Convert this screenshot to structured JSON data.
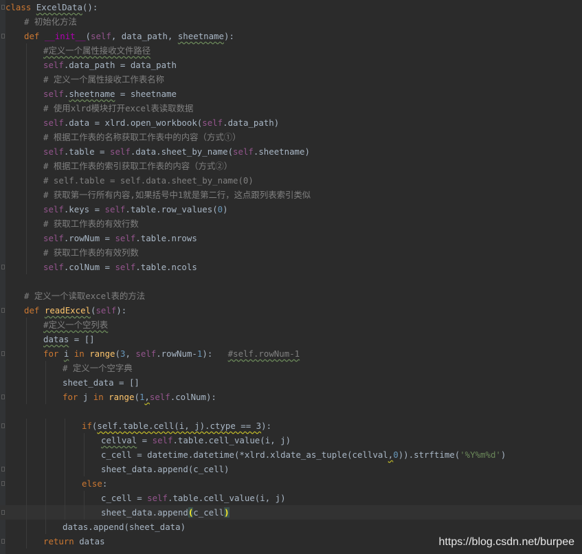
{
  "editor": {
    "lines": [
      [
        {
          "t": "class",
          "c": "kw"
        },
        {
          "t": " "
        },
        {
          "t": "ExcelData",
          "c": "squig"
        },
        {
          "t": "():"
        }
      ],
      [
        {
          "t": "# 初始化方法",
          "c": "cmt"
        }
      ],
      [
        {
          "t": "def",
          "c": "kw"
        },
        {
          "t": " "
        },
        {
          "t": "__init__",
          "c": "magic"
        },
        {
          "t": "("
        },
        {
          "t": "self",
          "c": "self"
        },
        {
          "t": ", data_path, "
        },
        {
          "t": "sheetname",
          "c": "squig"
        },
        {
          "t": "):"
        }
      ],
      [
        {
          "t": "#定义一个属性接收文件路径",
          "c": "cmt squig"
        }
      ],
      [
        {
          "t": "self",
          "c": "self"
        },
        {
          "t": ".data_path = data_path"
        }
      ],
      [
        {
          "t": "# 定义一个属性接收工作表名称",
          "c": "cmt"
        }
      ],
      [
        {
          "t": "self",
          "c": "self"
        },
        {
          "t": "."
        },
        {
          "t": "sheetname",
          "c": "squig"
        },
        {
          "t": " = sheetname"
        }
      ],
      [
        {
          "t": "# 使用xlrd模块打开excel表读取数据",
          "c": "cmt"
        }
      ],
      [
        {
          "t": "self",
          "c": "self"
        },
        {
          "t": ".data = xlrd.open_workbook("
        },
        {
          "t": "self",
          "c": "self"
        },
        {
          "t": ".data_path)"
        }
      ],
      [
        {
          "t": "# 根据工作表的名称获取工作表中的内容（方式①）",
          "c": "cmt"
        }
      ],
      [
        {
          "t": "self",
          "c": "self"
        },
        {
          "t": ".table = "
        },
        {
          "t": "self",
          "c": "self"
        },
        {
          "t": ".data.sheet_by_name("
        },
        {
          "t": "self",
          "c": "self"
        },
        {
          "t": ".sheetname)"
        }
      ],
      [
        {
          "t": "# 根据工作表的索引获取工作表的内容（方式②）",
          "c": "cmt"
        }
      ],
      [
        {
          "t": "# self.table = self.data.sheet_by_name(0)",
          "c": "cmt"
        }
      ],
      [
        {
          "t": "# 获取第一行所有内容,如果括号中1就是第二行，这点跟列表索引类似",
          "c": "cmt"
        }
      ],
      [
        {
          "t": "self",
          "c": "self"
        },
        {
          "t": ".keys = "
        },
        {
          "t": "self",
          "c": "self"
        },
        {
          "t": ".table.row_values("
        },
        {
          "t": "0",
          "c": "num"
        },
        {
          "t": ")"
        }
      ],
      [
        {
          "t": "# 获取工作表的有效行数",
          "c": "cmt"
        }
      ],
      [
        {
          "t": "self",
          "c": "self"
        },
        {
          "t": ".rowNum = "
        },
        {
          "t": "self",
          "c": "self"
        },
        {
          "t": ".table.nrows"
        }
      ],
      [
        {
          "t": "# 获取工作表的有效列数",
          "c": "cmt"
        }
      ],
      [
        {
          "t": "self",
          "c": "self"
        },
        {
          "t": ".colNum = "
        },
        {
          "t": "self",
          "c": "self"
        },
        {
          "t": ".table.ncols"
        }
      ],
      [],
      [
        {
          "t": "# 定义一个读取excel表的方法",
          "c": "cmt"
        }
      ],
      [
        {
          "t": "def",
          "c": "kw"
        },
        {
          "t": " "
        },
        {
          "t": "readExcel",
          "c": "fn squig"
        },
        {
          "t": "("
        },
        {
          "t": "self",
          "c": "self"
        },
        {
          "t": "):"
        }
      ],
      [
        {
          "t": "#定义一个空列表",
          "c": "cmt squig"
        }
      ],
      [
        {
          "t": "datas",
          "c": "squig"
        },
        {
          "t": " = []"
        }
      ],
      [
        {
          "t": "for",
          "c": "kw"
        },
        {
          "t": " "
        },
        {
          "t": "i",
          "c": "squig"
        },
        {
          "t": " "
        },
        {
          "t": "in",
          "c": "kw"
        },
        {
          "t": " "
        },
        {
          "t": "range",
          "c": "fn"
        },
        {
          "t": "("
        },
        {
          "t": "3",
          "c": "num"
        },
        {
          "t": ", "
        },
        {
          "t": "self",
          "c": "self"
        },
        {
          "t": ".rowNum-"
        },
        {
          "t": "1",
          "c": "num"
        },
        {
          "t": "):   "
        },
        {
          "t": "#self.rowNum-1",
          "c": "cmt squig"
        }
      ],
      [
        {
          "t": "# 定义一个空字典",
          "c": "cmt"
        }
      ],
      [
        {
          "t": "sheet_data = []"
        }
      ],
      [
        {
          "t": "for",
          "c": "kw"
        },
        {
          "t": " j "
        },
        {
          "t": "in",
          "c": "kw"
        },
        {
          "t": " "
        },
        {
          "t": "range",
          "c": "fn"
        },
        {
          "t": "("
        },
        {
          "t": "1",
          "c": "num"
        },
        {
          "t": ",",
          "c": "warn"
        },
        {
          "t": "self",
          "c": "self"
        },
        {
          "t": ".colNum):"
        }
      ],
      [],
      [
        {
          "t": "if",
          "c": "kw"
        },
        {
          "t": "("
        },
        {
          "t": "self.table.cell(i, j).ctype == 3",
          "c": "warn"
        },
        {
          "t": "):"
        }
      ],
      [
        {
          "t": "cellval",
          "c": "squig"
        },
        {
          "t": " = "
        },
        {
          "t": "self",
          "c": "self"
        },
        {
          "t": ".table.cell_value(i, j)"
        }
      ],
      [
        {
          "t": "c_cell = datetime.datetime(*xlrd.xldate_as_tuple(cellval"
        },
        {
          "t": ",",
          "c": "warn"
        },
        {
          "t": "0",
          "c": "num"
        },
        {
          "t": ")).strftime("
        },
        {
          "t": "'%Y%m%d'",
          "c": "str"
        },
        {
          "t": ")"
        }
      ],
      [
        {
          "t": "sheet_data.append(c_cell)"
        }
      ],
      [
        {
          "t": "else",
          "c": "kw"
        },
        {
          "t": ":"
        }
      ],
      [
        {
          "t": "c_cell = "
        },
        {
          "t": "self",
          "c": "self"
        },
        {
          "t": ".table.cell_value(i, j)"
        }
      ],
      [
        {
          "t": "sheet_data.append"
        },
        {
          "t": "(",
          "c": "brace-match"
        },
        {
          "t": "c_cell"
        },
        {
          "t": ")",
          "c": "brace-match"
        }
      ],
      [
        {
          "t": "datas.append(sheet_data)"
        }
      ],
      [
        {
          "t": "return",
          "c": "kw"
        },
        {
          "t": " datas"
        }
      ]
    ]
  },
  "watermark": "https://blog.csdn.net/burpee"
}
